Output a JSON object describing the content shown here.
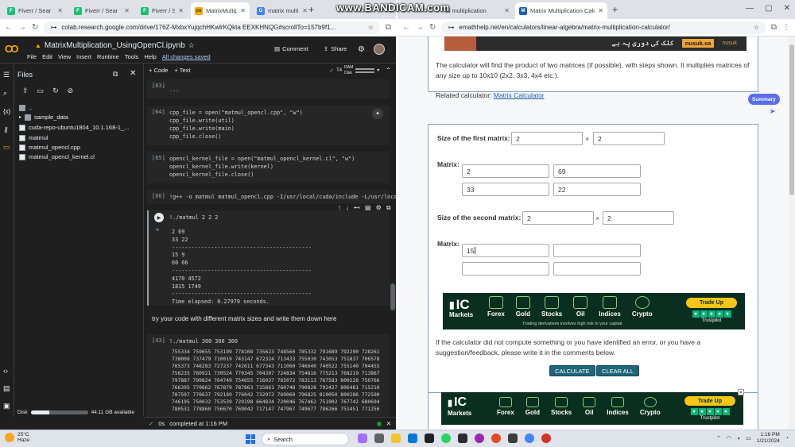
{
  "left_browser": {
    "tabs": [
      {
        "label": "Fiverr / Sear",
        "favicon_color": "#1dbf73"
      },
      {
        "label": "Fiverr / Sear",
        "favicon_color": "#1dbf73"
      },
      {
        "label": "Fiverr / Sear",
        "favicon_color": "#1dbf73"
      },
      {
        "label": "MatrixMultip",
        "favicon_color": "#f9ab00",
        "active": true
      },
      {
        "label": "matrix multi",
        "favicon_color": "#4285f4"
      }
    ],
    "url": "colab.research.google.com/drive/176Z-MxbxYujqchHKwlrKQkta EEXKHNQG#scrollTo=157b9f1...",
    "colab": {
      "logo": "CO",
      "title": "MatrixMultiplication_UsingOpenCl.ipynb",
      "menu": [
        "File",
        "Edit",
        "View",
        "Insert",
        "Runtime",
        "Tools",
        "Help"
      ],
      "saved_status": "All changes saved",
      "comment_label": "Comment",
      "share_label": "Share",
      "add_code_label": "+ Code",
      "add_text_label": "+ Text",
      "runtime_badge": "T4",
      "ram_label": "RAM",
      "disk_label": "Disk",
      "files_title": "Files",
      "file_tree": [
        {
          "name": "..",
          "type": "folder"
        },
        {
          "name": "sample_data",
          "type": "folder"
        },
        {
          "name": "cuda-repo-ubuntu1804_10.1.168-1_...",
          "type": "file"
        },
        {
          "name": "matmul",
          "type": "file"
        },
        {
          "name": "matmul_opencl.cpp",
          "type": "file"
        },
        {
          "name": "matmul_opencl_kernel.cl",
          "type": "file"
        }
      ],
      "disk_text": "Disk",
      "disk_available": "44.11 GB available",
      "disk_used_fraction": 0.32,
      "cells": [
        {
          "num": "[63]",
          "code": "..."
        },
        {
          "num": "[64]",
          "lines": [
            "cpp_file = open(\"matmul_opencl.cpp\", \"w\")",
            "cpp_file.write(util)",
            "cpp_file.write(main)",
            "cpp_file.close()"
          ]
        },
        {
          "num": "[65]",
          "lines": [
            "opencl_kernel_file = open(\"matmul_opencl_kernel.cl\", \"w\")",
            "opencl_kernel_file.write(kernel)",
            "opencl_kernel_file.close()"
          ]
        },
        {
          "num": "[66]",
          "code": "!g++ -o matmul matmul_opencl.cpp -I/usr/local/cuda/include -L/usr/local"
        },
        {
          "num": "",
          "code": "!./matmul 2 2 2"
        }
      ],
      "run_output": [
        "2 69",
        "33 22",
        "-------------------------------------------",
        "15 9",
        "60 66",
        "-------------------------------------------",
        "4170 4572",
        "1815 1749",
        "-------------------------------------------",
        "Time elapsed: 0.27979 seconds."
      ],
      "text_cell": "try your code with different matrix sizes and write them down here",
      "cell_43": {
        "num": "[43]",
        "code": "!./matmul 300 300 300"
      },
      "big_output": [
        "755334 759655 753199 778108 735623 748560 785332 791689 792290 728261",
        "738008 737479 710019 743147 672324 713433 755030 743053 751837 706578",
        "765373 746283 727237 742611 677343 711060 746640 740522 755140 704455",
        "756235 760921 730524 770345 704397 724834 754816 775213 768219 713867",
        "797887 799824 764749 754655 716037 765072 783113 767583 800228 750766",
        "766395 770662 767879 787863 715861 760748 790828 792427 806481 715210",
        "787597 770637 792189 776042 732973 769060 796825 810050 800286 772590",
        "746195 750032 753539 729198 664834 720046 767462 751902 767742 680694",
        "780531 778860 756670 769042 717147 747967 749677 786266 751451 771256"
      ],
      "status_text": "completed at 1:16 PM",
      "status_time": "0s"
    }
  },
  "right_browser": {
    "watermark": "www.BANDICAM.com",
    "tabs": [
      {
        "label": "ix multiplication",
        "favicon_color": "#4285f4"
      },
      {
        "label": "Matrix Multiplication Calculator",
        "favicon_color": "#1a5ea8",
        "active": true
      }
    ],
    "url": "emathhelp.net/en/calculators/linear-algebra/matrix-multiplication-calculator/",
    "top_ad": {
      "text": "کلک کی دوری پہ ہے",
      "brand": "nusuk.sa",
      "brand2": "nusuk"
    },
    "description": "The calculator will find the product of two matrices (if possible), with steps shown. It multiplies matrices of any size up to 10x10 (2x2, 3x3, 4x4 etc.).",
    "related_label": "Related calculator:",
    "related_link": "Matrix Calculator",
    "summary_badge": "Summary",
    "first_size_label": "Size of the first matrix:",
    "first_size": [
      "2",
      "2"
    ],
    "first_matrix_label": "Matrix:",
    "first_matrix": [
      [
        "2",
        "69"
      ],
      [
        "33",
        "22"
      ]
    ],
    "second_size_label": "Size of the second matrix:",
    "second_size": [
      "2",
      "2"
    ],
    "second_matrix_label": "Matrix:",
    "second_matrix": [
      [
        "15",
        ""
      ],
      [
        "",
        ""
      ]
    ],
    "times_symbol": "×",
    "ad": {
      "brand": "IC",
      "brand_sub": "Markets",
      "items": [
        "Forex",
        "Gold",
        "Stocks",
        "Oil",
        "Indices",
        "Crypto"
      ],
      "tagline": "Trading derivatives involves high risk to your capital",
      "cta": "Trade Up",
      "trust": "Trustpilot",
      "stars": [
        "★",
        "★",
        "★",
        "★",
        "★"
      ]
    },
    "feedback_note": "If the calculator did not compute something or you have identified an error, or you have a suggestion/feedback, please write it in the comments below.",
    "calculate_label": "CALCULATE",
    "clear_label": "CLEAR ALL"
  },
  "taskbar": {
    "temp": "25°C",
    "weather": "Haze",
    "search_placeholder": "Search",
    "time": "1:16 PM",
    "date": "1/21/2024"
  },
  "colors": {
    "colab_bg": "#1f1f1f",
    "accent_blue": "#1a5ea8",
    "button_teal": "#1f6678",
    "ad_green": "#0a2e1f"
  }
}
